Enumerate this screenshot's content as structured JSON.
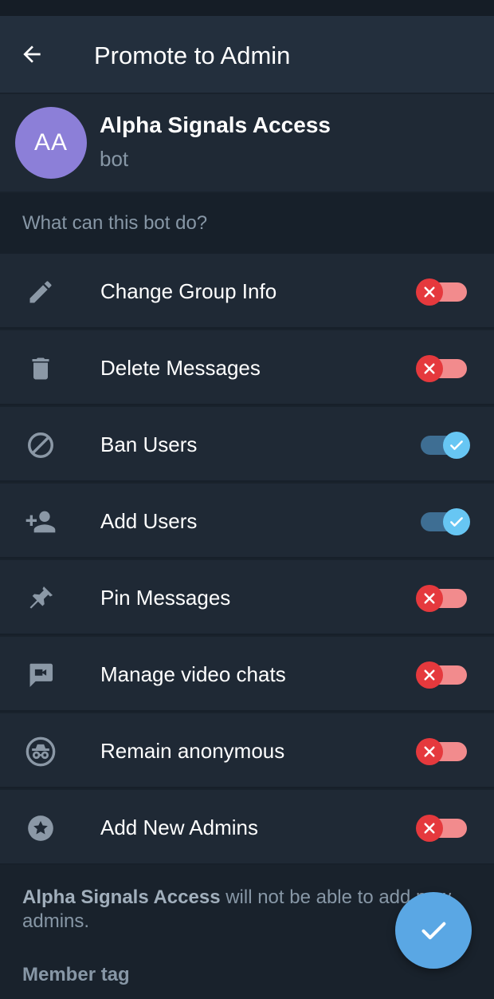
{
  "header": {
    "title": "Promote to Admin"
  },
  "profile": {
    "initials": "AA",
    "name": "Alpha Signals Access",
    "subtitle": "bot",
    "avatar_color": "#8c7fd8"
  },
  "section": {
    "title": "What can this bot do?"
  },
  "permissions": [
    {
      "label": "Change Group Info",
      "icon": "pencil-icon",
      "enabled": false
    },
    {
      "label": "Delete Messages",
      "icon": "trash-icon",
      "enabled": false
    },
    {
      "label": "Ban Users",
      "icon": "ban-icon",
      "enabled": true
    },
    {
      "label": "Add Users",
      "icon": "add-user-icon",
      "enabled": true
    },
    {
      "label": "Pin Messages",
      "icon": "pin-icon",
      "enabled": false
    },
    {
      "label": "Manage video chats",
      "icon": "video-chat-icon",
      "enabled": false
    },
    {
      "label": "Remain anonymous",
      "icon": "incognito-icon",
      "enabled": false
    },
    {
      "label": "Add New Admins",
      "icon": "star-icon",
      "enabled": false
    }
  ],
  "footer": {
    "note_name": "Alpha Signals Access",
    "note_text": " will not be able to add new admins.",
    "member_tag": "Member tag"
  },
  "colors": {
    "background": "#19222c",
    "row": "#1f2935",
    "toggle_off": "#e5393d",
    "toggle_on": "#67c6f3",
    "fab": "#5aa7e4"
  }
}
